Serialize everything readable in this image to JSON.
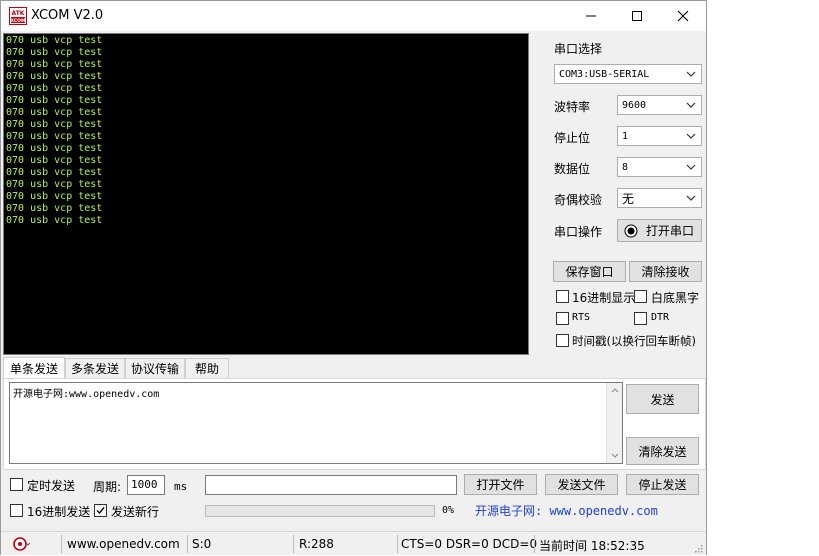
{
  "window": {
    "title": "XCOM V2.0",
    "logo_text": "ATK XCOM",
    "accent_color": "#c0000b"
  },
  "console": {
    "text_color": "#b6f14b",
    "lines": [
      "070 usb vcp test",
      "070 usb vcp test",
      "070 usb vcp test",
      "070 usb vcp test",
      "070 usb vcp test",
      "070 usb vcp test",
      "070 usb vcp test",
      "070 usb vcp test",
      "070 usb vcp test",
      "070 usb vcp test",
      "070 usb vcp test",
      "070 usb vcp test",
      "070 usb vcp test",
      "070 usb vcp test",
      "070 usb vcp test",
      "070 usb vcp test"
    ]
  },
  "settings": {
    "port_label": "串口选择",
    "port_value": "COM3:USB-SERIAL",
    "baud_label": "波特率",
    "baud_value": "9600",
    "stop_label": "停止位",
    "stop_value": "1",
    "data_label": "数据位",
    "data_value": "8",
    "parity_label": "奇偶校验",
    "parity_value": "无",
    "op_label": "串口操作",
    "open_port_label": "打开串口",
    "save_window_label": "保存窗口",
    "clear_recv_label": "清除接收",
    "hex_display_label": "16进制显示",
    "white_black_label": "白底黑字",
    "rts_label": "RTS",
    "dtr_label": "DTR",
    "timestamp_label": "时间戳(以换行回车断帧)"
  },
  "tabs": [
    "单条发送",
    "多条发送",
    "协议传输",
    "帮助"
  ],
  "send": {
    "text": "开源电子网:www.openedv.com",
    "send_label": "发送",
    "clear_send_label": "清除发送",
    "timed_send_label": "定时发送",
    "period_label": "周期:",
    "period_value": "1000",
    "period_unit": "ms",
    "open_file_label": "打开文件",
    "send_file_label": "发送文件",
    "stop_send_label": "停止发送",
    "hex_send_label": "16进制发送",
    "send_newline_label": "发送新行",
    "progress_text": "0%",
    "progress_fraction": 0,
    "promo_text": "开源电子网: www.openedv.com"
  },
  "status": {
    "website": "www.openedv.com",
    "sent": "S:0",
    "received": "R:288",
    "lines": "CTS=0 DSR=0 DCD=0",
    "time": "当前时间 18:52:35"
  }
}
